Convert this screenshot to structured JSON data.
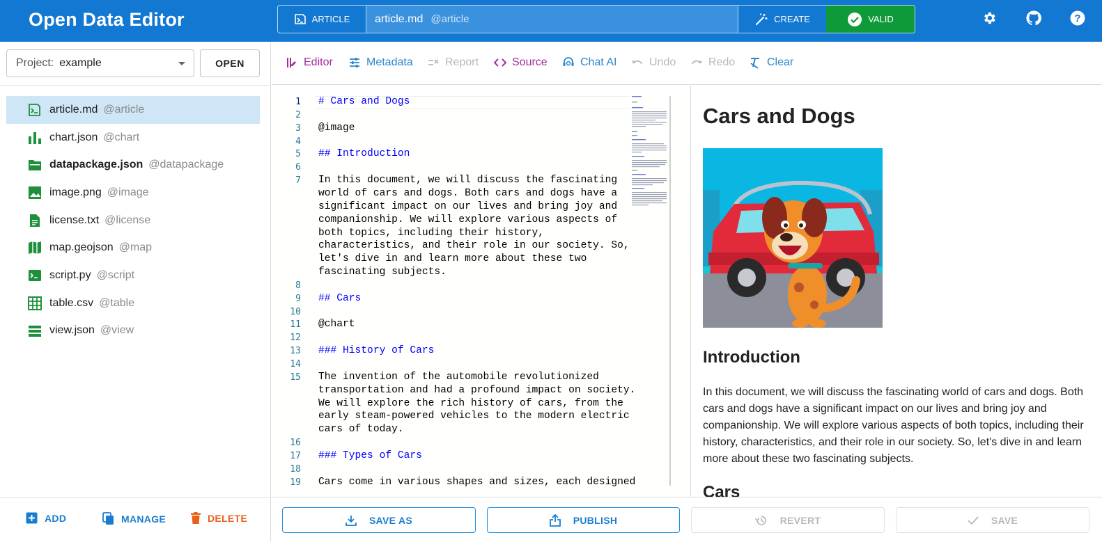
{
  "app": {
    "title": "Open Data Editor"
  },
  "header": {
    "type_label": "ARTICLE",
    "path": "article.md",
    "path_tag": "@article",
    "create_label": "CREATE",
    "valid_label": "VALID"
  },
  "project": {
    "label": "Project:",
    "value": "example",
    "open_label": "OPEN"
  },
  "files": [
    {
      "name": "article.md",
      "tag": "@article",
      "icon": "article-icon",
      "active": true
    },
    {
      "name": "chart.json",
      "tag": "@chart",
      "icon": "chart-icon"
    },
    {
      "name": "datapackage.json",
      "tag": "@datapackage",
      "icon": "folder-icon",
      "bold": true
    },
    {
      "name": "image.png",
      "tag": "@image",
      "icon": "image-icon"
    },
    {
      "name": "license.txt",
      "tag": "@license",
      "icon": "file-text-icon"
    },
    {
      "name": "map.geojson",
      "tag": "@map",
      "icon": "map-icon"
    },
    {
      "name": "script.py",
      "tag": "@script",
      "icon": "terminal-icon"
    },
    {
      "name": "table.csv",
      "tag": "@table",
      "icon": "table-icon"
    },
    {
      "name": "view.json",
      "tag": "@view",
      "icon": "view-icon"
    }
  ],
  "left_actions": {
    "add": "ADD",
    "manage": "MANAGE",
    "delete": "DELETE"
  },
  "toolbar": {
    "editor": "Editor",
    "metadata": "Metadata",
    "report": "Report",
    "source": "Source",
    "chat_ai": "Chat AI",
    "undo": "Undo",
    "redo": "Redo",
    "clear": "Clear"
  },
  "editor": {
    "lines": [
      {
        "n": "1",
        "rows": [
          "# Cars and Dogs"
        ],
        "heading": true
      },
      {
        "n": "2",
        "rows": [
          ""
        ]
      },
      {
        "n": "3",
        "rows": [
          "@image"
        ]
      },
      {
        "n": "4",
        "rows": [
          ""
        ]
      },
      {
        "n": "5",
        "rows": [
          "## Introduction"
        ],
        "heading": true
      },
      {
        "n": "6",
        "rows": [
          ""
        ]
      },
      {
        "n": "7",
        "rows": [
          "In this document, we will discuss the fascinating",
          "world of cars and dogs. Both cars and dogs have a",
          "significant impact on our lives and bring joy and",
          "companionship. We will explore various aspects of",
          "both topics, including their history,",
          "characteristics, and their role in our society. So,",
          "let's dive in and learn more about these two",
          "fascinating subjects."
        ]
      },
      {
        "n": "8",
        "rows": [
          ""
        ]
      },
      {
        "n": "9",
        "rows": [
          "## Cars"
        ],
        "heading": true
      },
      {
        "n": "10",
        "rows": [
          ""
        ]
      },
      {
        "n": "11",
        "rows": [
          "@chart"
        ]
      },
      {
        "n": "12",
        "rows": [
          ""
        ]
      },
      {
        "n": "13",
        "rows": [
          "### History of Cars"
        ],
        "heading": true
      },
      {
        "n": "14",
        "rows": [
          ""
        ]
      },
      {
        "n": "15",
        "rows": [
          "The invention of the automobile revolutionized",
          "transportation and had a profound impact on society.",
          "We will explore the rich history of cars, from the",
          "early steam-powered vehicles to the modern electric",
          "cars of today."
        ]
      },
      {
        "n": "16",
        "rows": [
          ""
        ]
      },
      {
        "n": "17",
        "rows": [
          "### Types of Cars"
        ],
        "heading": true
      },
      {
        "n": "18",
        "rows": [
          ""
        ]
      },
      {
        "n": "19",
        "rows": [
          "Cars come in various shapes and sizes, each designed"
        ]
      }
    ]
  },
  "preview": {
    "title": "Cars and Dogs",
    "h2": "Introduction",
    "paragraph": "In this document, we will discuss the fascinating world of cars and dogs. Both cars and dogs have a significant impact on our lives and bring joy and companionship. We will explore various aspects of both topics, including their history, characteristics, and their role in our society. So, let's dive in and learn more about these two fascinating subjects.",
    "h2b": "Cars"
  },
  "bottom": {
    "save_as": "SAVE AS",
    "publish": "PUBLISH",
    "revert": "REVERT",
    "save": "SAVE"
  },
  "colors": {
    "brand": "#1278d2",
    "valid": "#0e9a38",
    "file_icon": "#1e8f3a",
    "editor_active": "#a52a9c",
    "link": "#2a86cc",
    "delete": "#e8601c",
    "disabled": "#b8b8b8"
  }
}
